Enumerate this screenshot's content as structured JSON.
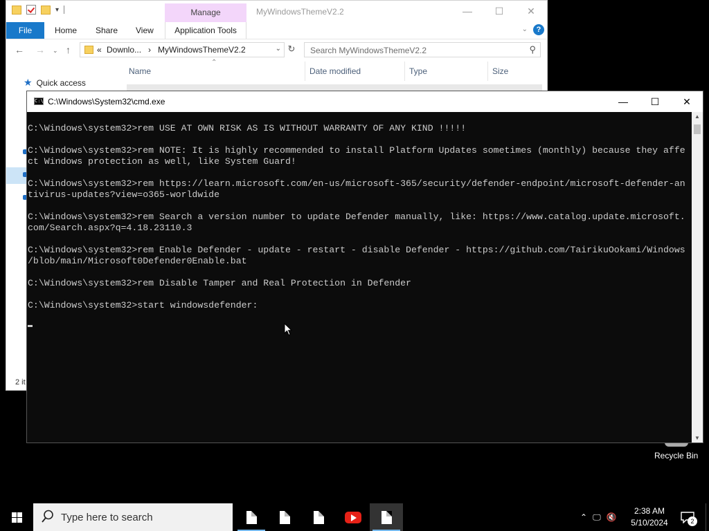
{
  "explorer": {
    "title": "MyWindowsThemeV2.2",
    "manage_tab": "Manage",
    "ribbon": {
      "file": "File",
      "home": "Home",
      "share": "Share",
      "view": "View",
      "app_tools": "Application Tools"
    },
    "address": {
      "chevrons": "«",
      "segment1": "Downlo...",
      "separator": "›",
      "segment2": "MyWindowsThemeV2.2"
    },
    "search_placeholder": "Search MyWindowsThemeV2.2",
    "columns": {
      "name": "Name",
      "date_modified": "Date modified",
      "type": "Type",
      "size": "Size"
    },
    "quick_access": "Quick access",
    "status": "2 it"
  },
  "cmd": {
    "title": "C:\\Windows\\System32\\cmd.exe",
    "lines": [
      "C:\\Windows\\system32>rem USE AT OWN RISK AS IS WITHOUT WARRANTY OF ANY KIND !!!!!",
      "",
      "C:\\Windows\\system32>rem NOTE: It is highly recommended to install Platform Updates sometimes (monthly) because they affe",
      "ct Windows protection as well, like System Guard!",
      "",
      "C:\\Windows\\system32>rem https://learn.microsoft.com/en-us/microsoft-365/security/defender-endpoint/microsoft-defender-an",
      "tivirus-updates?view=o365-worldwide",
      "",
      "C:\\Windows\\system32>rem Search a version number to update Defender manually, like: https://www.catalog.update.microsoft.",
      "com/Search.aspx?q=4.18.23110.3",
      "",
      "C:\\Windows\\system32>rem Enable Defender - update - restart - disable Defender - https://github.com/TairikuOokami/Windows",
      "/blob/main/Microsoft0Defender0Enable.bat",
      "",
      "C:\\Windows\\system32>rem Disable Tamper and Real Protection in Defender",
      "",
      "C:\\Windows\\system32>start windowsdefender:",
      ""
    ]
  },
  "desktop": {
    "recycle_bin": "Recycle Bin"
  },
  "taskbar": {
    "search_placeholder": "Type here to search",
    "time": "2:38 AM",
    "date": "5/10/2024",
    "notification_count": "2"
  },
  "colors": {
    "accent": "#1979ca",
    "manage_tab": "#f3d6fa",
    "console_bg": "#0c0c0c",
    "console_text": "#cccccc",
    "taskbar": "#000000"
  }
}
